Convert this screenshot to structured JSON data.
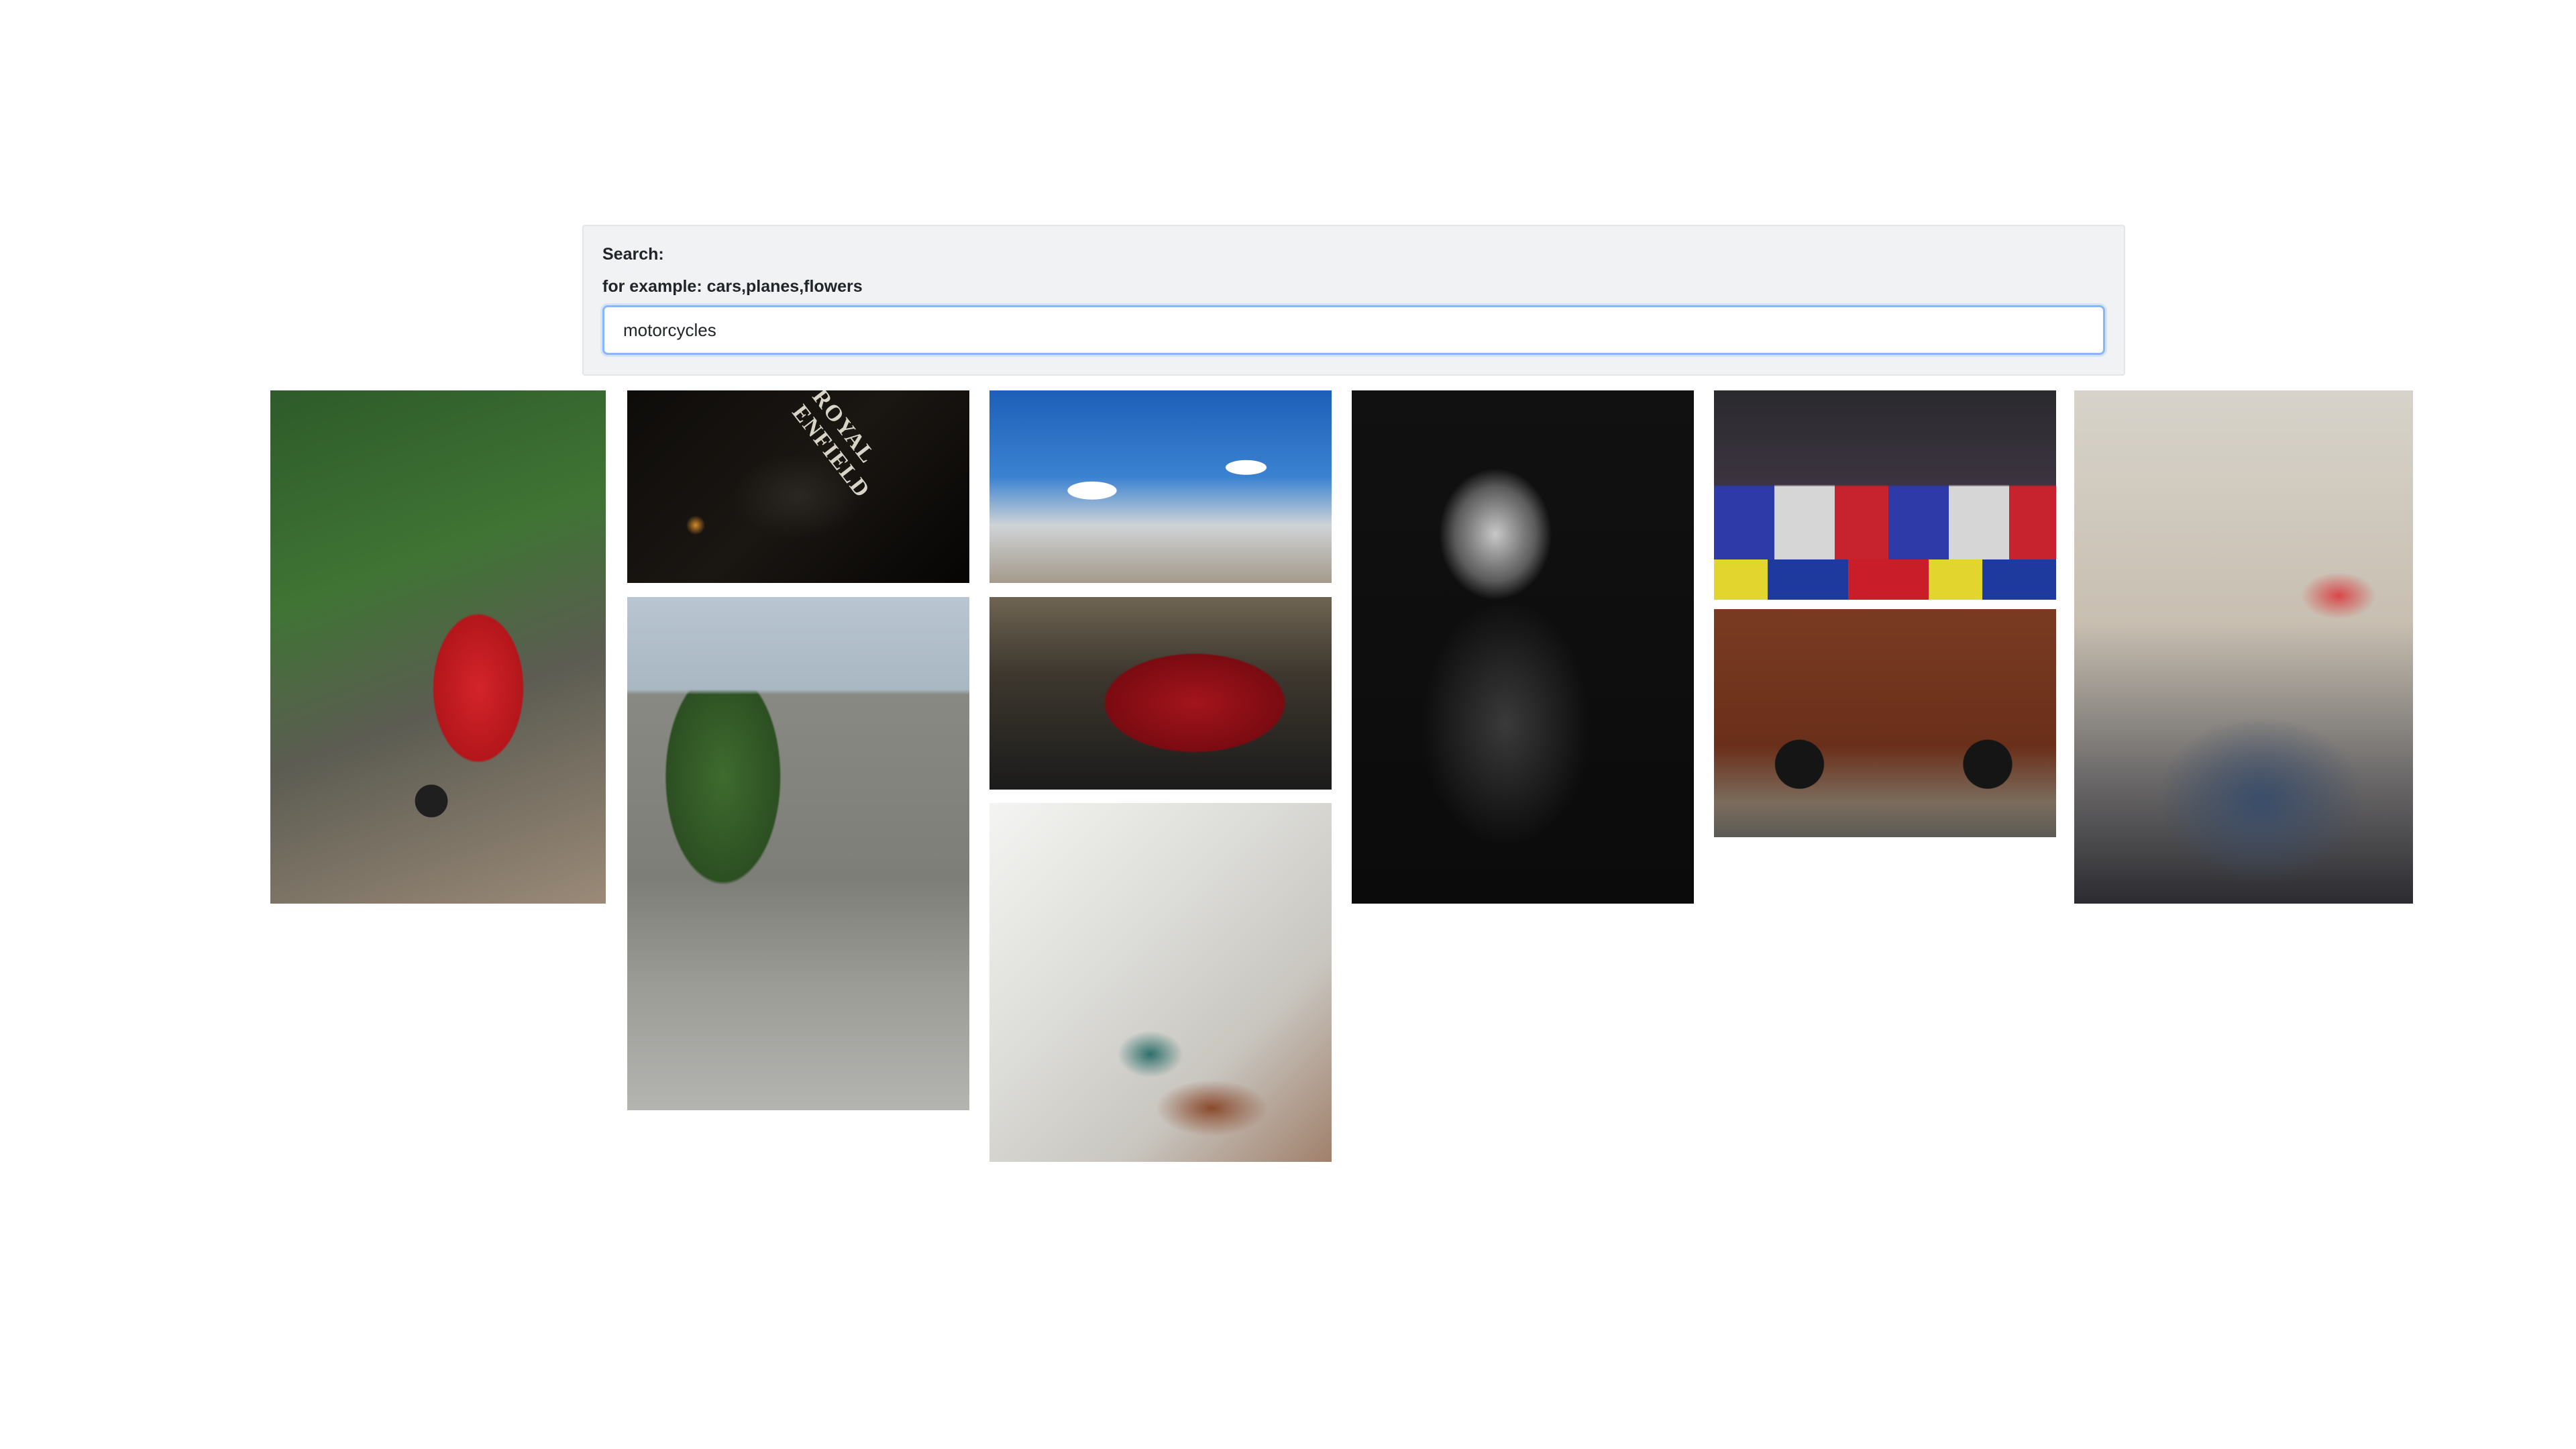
{
  "search": {
    "label": "Search:",
    "hint": "for example: cars,planes,flowers",
    "value": "motorcycles"
  },
  "gallery": {
    "images": [
      {
        "subject": "red scooter by ivy wall"
      },
      {
        "subject": "royal enfield tank emblem",
        "text": "ROYAL ENFIELD"
      },
      {
        "subject": "tree-lined street with parked motorcycles"
      },
      {
        "subject": "mountain road under blue sky"
      },
      {
        "subject": "red motorcycle fuel tank"
      },
      {
        "subject": "motorcycle in white courtyard"
      },
      {
        "subject": "rider in helmet in the dark"
      },
      {
        "subject": "motocross jump over crowd"
      },
      {
        "subject": "classic motorcycle against wood wall"
      },
      {
        "subject": "crowded street with motorcycles"
      }
    ]
  }
}
